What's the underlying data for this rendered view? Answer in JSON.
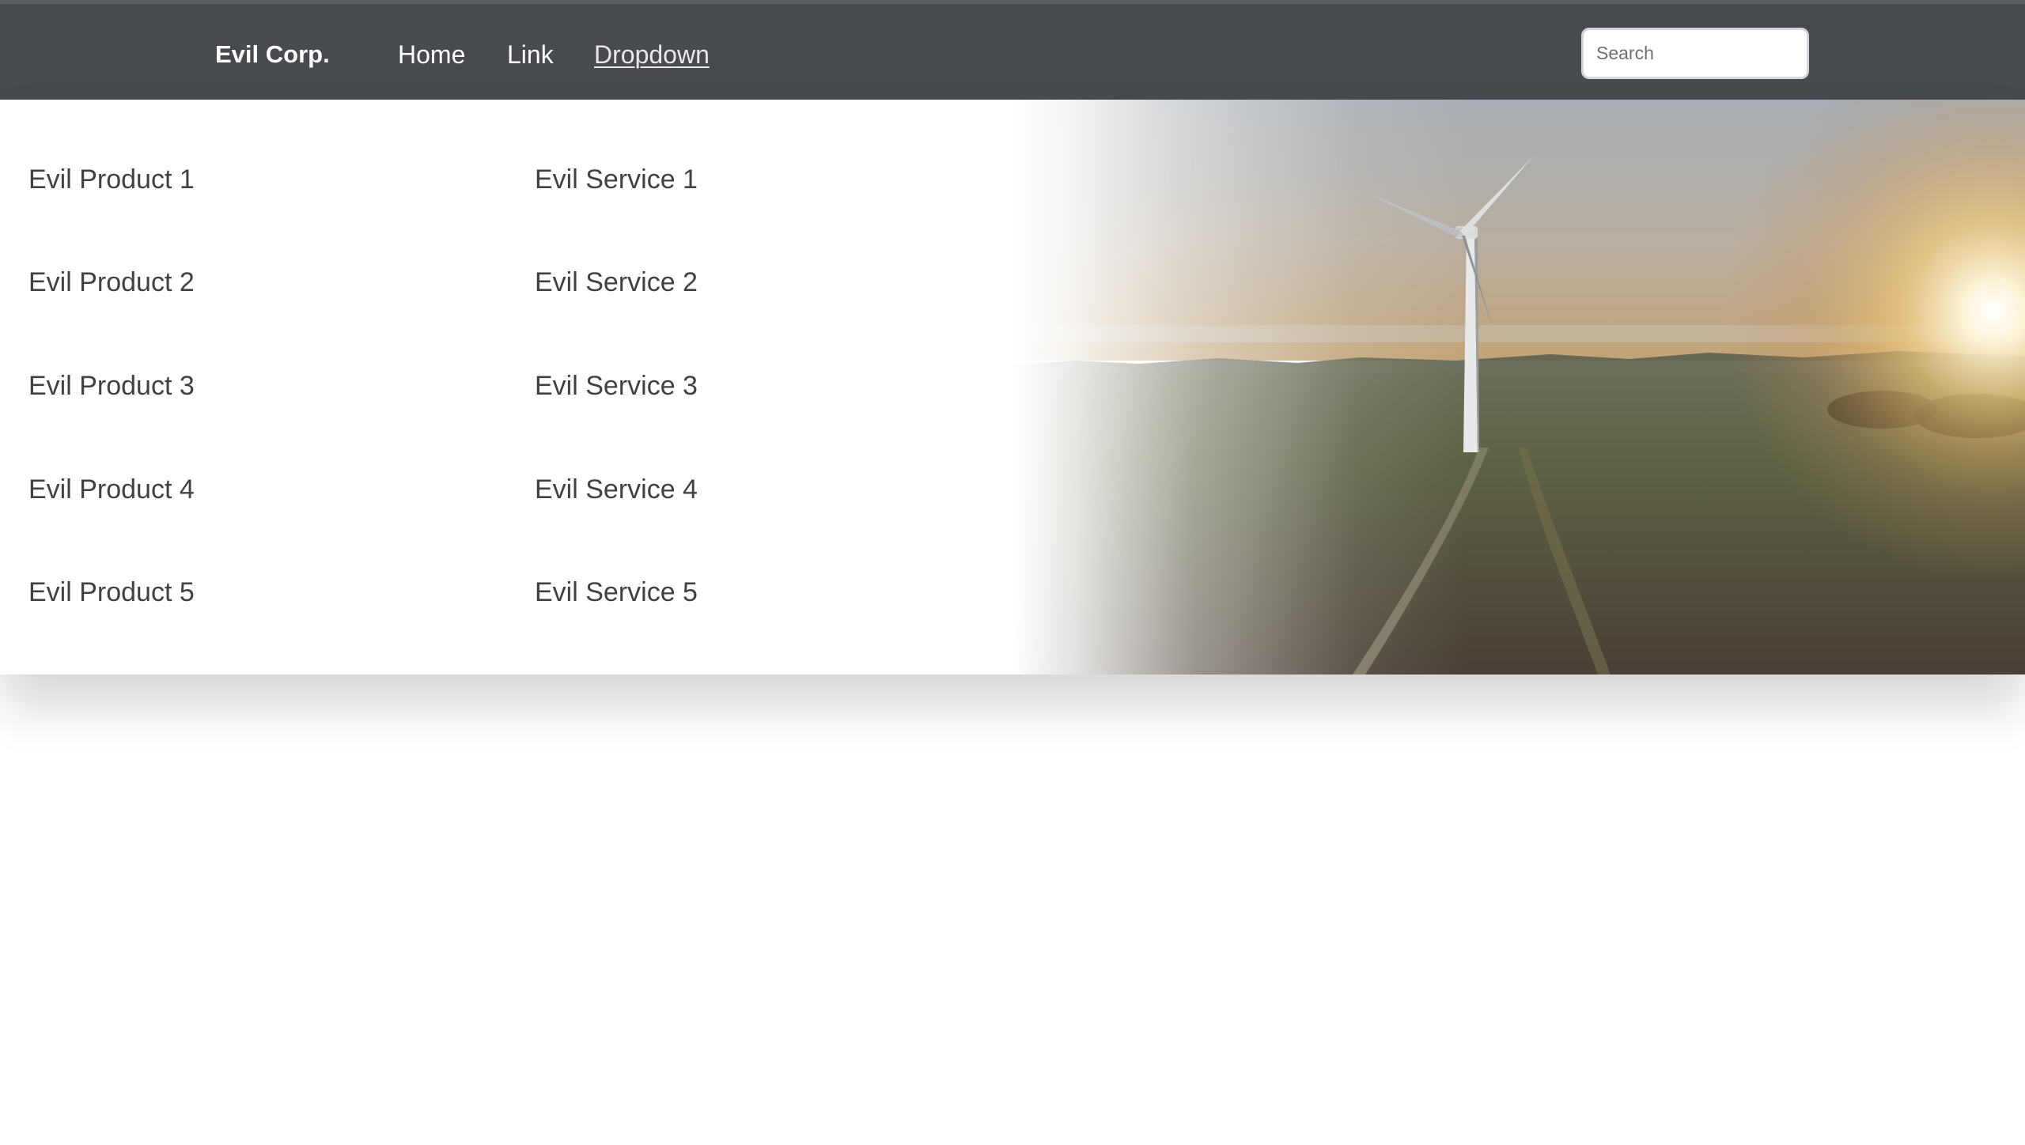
{
  "navbar": {
    "brand": "Evil Corp.",
    "links": [
      {
        "label": "Home"
      },
      {
        "label": "Link"
      },
      {
        "label": "Dropdown"
      }
    ],
    "search": {
      "placeholder": "Search",
      "value": ""
    }
  },
  "dropdown": {
    "products": [
      {
        "label": "Evil Product 1"
      },
      {
        "label": "Evil Product 2"
      },
      {
        "label": "Evil Product 3"
      },
      {
        "label": "Evil Product 4"
      },
      {
        "label": "Evil Product 5"
      }
    ],
    "services": [
      {
        "label": "Evil Service 1"
      },
      {
        "label": "Evil Service 2"
      },
      {
        "label": "Evil Service 3"
      },
      {
        "label": "Evil Service 4"
      },
      {
        "label": "Evil Service 5"
      }
    ],
    "image": {
      "subject": "wind turbine over fields at sunset"
    }
  },
  "colors": {
    "navbar_bg": "#474a4f",
    "menu_text": "#3e4146",
    "page_bg": "#ffffff"
  }
}
